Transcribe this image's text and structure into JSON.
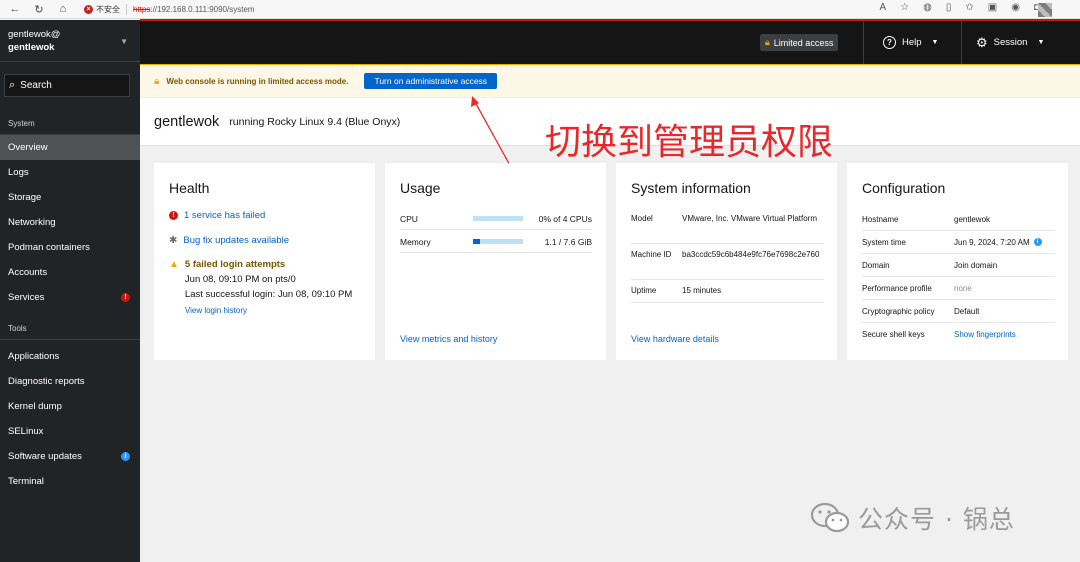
{
  "browser": {
    "security_label": "不安全",
    "url_scheme": "https",
    "url_rest": "://192.168.0.111:9090/system"
  },
  "sidebar": {
    "host_user": "gentlewok@",
    "host_name": "gentlewok",
    "search_label": "Search",
    "section_system": "System",
    "items": [
      {
        "label": "Overview",
        "active": true
      },
      {
        "label": "Logs"
      },
      {
        "label": "Storage"
      },
      {
        "label": "Networking"
      },
      {
        "label": "Podman containers"
      },
      {
        "label": "Accounts"
      },
      {
        "label": "Services",
        "badge": "!",
        "badge_color": "#c9190b"
      }
    ],
    "section_tools": "Tools",
    "tools": [
      {
        "label": "Applications"
      },
      {
        "label": "Diagnostic reports"
      },
      {
        "label": "Kernel dump"
      },
      {
        "label": "SELinux"
      },
      {
        "label": "Software updates",
        "badge": "i",
        "badge_color": "#2b9af3"
      },
      {
        "label": "Terminal"
      }
    ]
  },
  "masthead": {
    "limited_access": "Limited access",
    "help": "Help",
    "session": "Session"
  },
  "alert": {
    "text": "Web console is running in limited access mode.",
    "button": "Turn on administrative access"
  },
  "host": {
    "name": "gentlewok",
    "os": "running Rocky Linux 9.4 (Blue Onyx)"
  },
  "annotation": "切换到管理员权限",
  "health": {
    "title": "Health",
    "service_failed": "1 service has failed",
    "bug_fix": "Bug fix updates available",
    "failed_logins": "5 failed login attempts",
    "login_time": "Jun 08, 09:10 PM on pts/0",
    "last_login": "Last successful login: Jun 08, 09:10 PM",
    "history_link": "View login history"
  },
  "usage": {
    "title": "Usage",
    "cpu_label": "CPU",
    "cpu_value": "0% of 4 CPUs",
    "cpu_fraction": 0.0,
    "mem_label": "Memory",
    "mem_value": "1.1 / 7.6 GiB",
    "mem_fraction": 0.145,
    "footer": "View metrics and history"
  },
  "sysinfo": {
    "title": "System information",
    "model_label": "Model",
    "model_value": "VMware, Inc. VMware Virtual Platform",
    "machine_label": "Machine ID",
    "machine_value": "ba3ccdc59c6b484e9fc76e7698c2e760",
    "uptime_label": "Uptime",
    "uptime_value": "15 minutes",
    "footer": "View hardware details"
  },
  "config": {
    "title": "Configuration",
    "hostname_label": "Hostname",
    "hostname_value": "gentlewok",
    "time_label": "System time",
    "time_value": "Jun 9, 2024, 7:20 AM",
    "domain_label": "Domain",
    "domain_value": "Join domain",
    "perf_label": "Performance profile",
    "perf_value": "none",
    "crypto_label": "Cryptographic policy",
    "crypto_value": "Default",
    "ssh_label": "Secure shell keys",
    "ssh_value": "Show fingerprints"
  },
  "watermark": "公众号 · 锅总"
}
